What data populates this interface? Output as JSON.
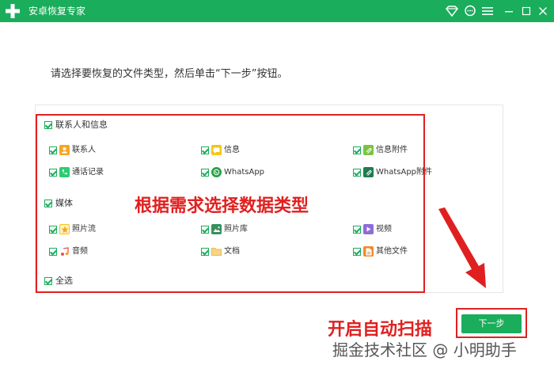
{
  "window": {
    "title": "安卓恢复专家",
    "controls": [
      "diamond-icon",
      "chat-icon",
      "menu-icon",
      "minimize-icon",
      "maximize-icon",
      "close-icon"
    ]
  },
  "instruction": "请选择要恢复的文件类型，然后单击“下一步”按钮。",
  "groups": {
    "contacts": {
      "label": "联系人和信息",
      "items": [
        {
          "label": "联系人",
          "icon": "contact-icon",
          "color": "#f5a623"
        },
        {
          "label": "信息",
          "icon": "message-icon",
          "color": "#f5c518"
        },
        {
          "label": "信息附件",
          "icon": "attachment-icon",
          "color": "#7cc242"
        },
        {
          "label": "通话记录",
          "icon": "phone-icon",
          "color": "#2ecc71"
        },
        {
          "label": "WhatsApp",
          "icon": "whatsapp-icon",
          "color": "#25a244"
        },
        {
          "label": "WhatsApp附件",
          "icon": "whatsapp-attachment-icon",
          "color": "#1e7c4d"
        }
      ]
    },
    "media": {
      "label": "媒体",
      "items": [
        {
          "label": "照片流",
          "icon": "photo-stream-icon",
          "color": "#f5c518"
        },
        {
          "label": "照片库",
          "icon": "photo-library-icon",
          "color": "#3a8f5e"
        },
        {
          "label": "视频",
          "icon": "video-icon",
          "color": "#8e6cd9"
        },
        {
          "label": "音频",
          "icon": "audio-icon",
          "color": "#e8554e"
        },
        {
          "label": "文档",
          "icon": "document-icon",
          "color": "#f5b942"
        },
        {
          "label": "其他文件",
          "icon": "other-file-icon",
          "color": "#f08c2e"
        }
      ]
    },
    "select_all": "全选"
  },
  "annotations": {
    "select_hint": "根据需求选择数据类型",
    "scan_hint": "开启自动扫描"
  },
  "next_button": "下一步",
  "watermark": "掘金技术社区 @ 小明助手",
  "colors": {
    "brand": "#1aad5b",
    "annotation": "#e02020"
  }
}
